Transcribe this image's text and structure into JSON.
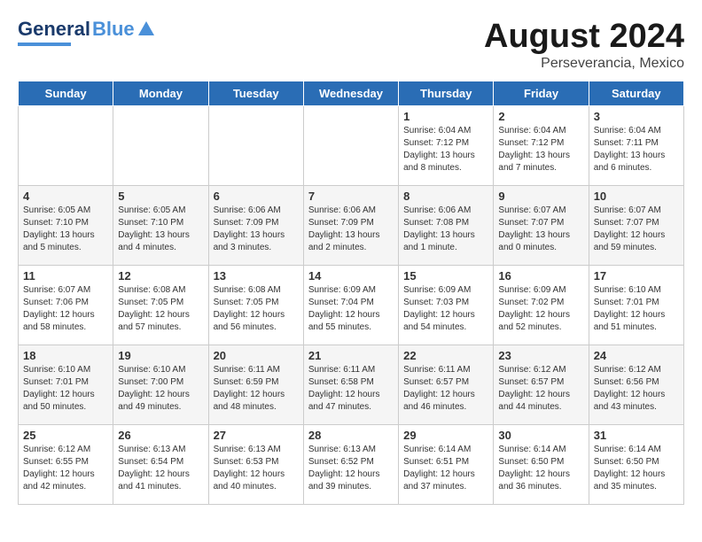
{
  "header": {
    "logo_general": "General",
    "logo_blue": "Blue",
    "month": "August 2024",
    "location": "Perseverancia, Mexico"
  },
  "days_of_week": [
    "Sunday",
    "Monday",
    "Tuesday",
    "Wednesday",
    "Thursday",
    "Friday",
    "Saturday"
  ],
  "weeks": [
    [
      {
        "day": "",
        "info": ""
      },
      {
        "day": "",
        "info": ""
      },
      {
        "day": "",
        "info": ""
      },
      {
        "day": "",
        "info": ""
      },
      {
        "day": "1",
        "info": "Sunrise: 6:04 AM\nSunset: 7:12 PM\nDaylight: 13 hours\nand 8 minutes."
      },
      {
        "day": "2",
        "info": "Sunrise: 6:04 AM\nSunset: 7:12 PM\nDaylight: 13 hours\nand 7 minutes."
      },
      {
        "day": "3",
        "info": "Sunrise: 6:04 AM\nSunset: 7:11 PM\nDaylight: 13 hours\nand 6 minutes."
      }
    ],
    [
      {
        "day": "4",
        "info": "Sunrise: 6:05 AM\nSunset: 7:10 PM\nDaylight: 13 hours\nand 5 minutes."
      },
      {
        "day": "5",
        "info": "Sunrise: 6:05 AM\nSunset: 7:10 PM\nDaylight: 13 hours\nand 4 minutes."
      },
      {
        "day": "6",
        "info": "Sunrise: 6:06 AM\nSunset: 7:09 PM\nDaylight: 13 hours\nand 3 minutes."
      },
      {
        "day": "7",
        "info": "Sunrise: 6:06 AM\nSunset: 7:09 PM\nDaylight: 13 hours\nand 2 minutes."
      },
      {
        "day": "8",
        "info": "Sunrise: 6:06 AM\nSunset: 7:08 PM\nDaylight: 13 hours\nand 1 minute."
      },
      {
        "day": "9",
        "info": "Sunrise: 6:07 AM\nSunset: 7:07 PM\nDaylight: 13 hours\nand 0 minutes."
      },
      {
        "day": "10",
        "info": "Sunrise: 6:07 AM\nSunset: 7:07 PM\nDaylight: 12 hours\nand 59 minutes."
      }
    ],
    [
      {
        "day": "11",
        "info": "Sunrise: 6:07 AM\nSunset: 7:06 PM\nDaylight: 12 hours\nand 58 minutes."
      },
      {
        "day": "12",
        "info": "Sunrise: 6:08 AM\nSunset: 7:05 PM\nDaylight: 12 hours\nand 57 minutes."
      },
      {
        "day": "13",
        "info": "Sunrise: 6:08 AM\nSunset: 7:05 PM\nDaylight: 12 hours\nand 56 minutes."
      },
      {
        "day": "14",
        "info": "Sunrise: 6:09 AM\nSunset: 7:04 PM\nDaylight: 12 hours\nand 55 minutes."
      },
      {
        "day": "15",
        "info": "Sunrise: 6:09 AM\nSunset: 7:03 PM\nDaylight: 12 hours\nand 54 minutes."
      },
      {
        "day": "16",
        "info": "Sunrise: 6:09 AM\nSunset: 7:02 PM\nDaylight: 12 hours\nand 52 minutes."
      },
      {
        "day": "17",
        "info": "Sunrise: 6:10 AM\nSunset: 7:01 PM\nDaylight: 12 hours\nand 51 minutes."
      }
    ],
    [
      {
        "day": "18",
        "info": "Sunrise: 6:10 AM\nSunset: 7:01 PM\nDaylight: 12 hours\nand 50 minutes."
      },
      {
        "day": "19",
        "info": "Sunrise: 6:10 AM\nSunset: 7:00 PM\nDaylight: 12 hours\nand 49 minutes."
      },
      {
        "day": "20",
        "info": "Sunrise: 6:11 AM\nSunset: 6:59 PM\nDaylight: 12 hours\nand 48 minutes."
      },
      {
        "day": "21",
        "info": "Sunrise: 6:11 AM\nSunset: 6:58 PM\nDaylight: 12 hours\nand 47 minutes."
      },
      {
        "day": "22",
        "info": "Sunrise: 6:11 AM\nSunset: 6:57 PM\nDaylight: 12 hours\nand 46 minutes."
      },
      {
        "day": "23",
        "info": "Sunrise: 6:12 AM\nSunset: 6:57 PM\nDaylight: 12 hours\nand 44 minutes."
      },
      {
        "day": "24",
        "info": "Sunrise: 6:12 AM\nSunset: 6:56 PM\nDaylight: 12 hours\nand 43 minutes."
      }
    ],
    [
      {
        "day": "25",
        "info": "Sunrise: 6:12 AM\nSunset: 6:55 PM\nDaylight: 12 hours\nand 42 minutes."
      },
      {
        "day": "26",
        "info": "Sunrise: 6:13 AM\nSunset: 6:54 PM\nDaylight: 12 hours\nand 41 minutes."
      },
      {
        "day": "27",
        "info": "Sunrise: 6:13 AM\nSunset: 6:53 PM\nDaylight: 12 hours\nand 40 minutes."
      },
      {
        "day": "28",
        "info": "Sunrise: 6:13 AM\nSunset: 6:52 PM\nDaylight: 12 hours\nand 39 minutes."
      },
      {
        "day": "29",
        "info": "Sunrise: 6:14 AM\nSunset: 6:51 PM\nDaylight: 12 hours\nand 37 minutes."
      },
      {
        "day": "30",
        "info": "Sunrise: 6:14 AM\nSunset: 6:50 PM\nDaylight: 12 hours\nand 36 minutes."
      },
      {
        "day": "31",
        "info": "Sunrise: 6:14 AM\nSunset: 6:50 PM\nDaylight: 12 hours\nand 35 minutes."
      }
    ]
  ]
}
